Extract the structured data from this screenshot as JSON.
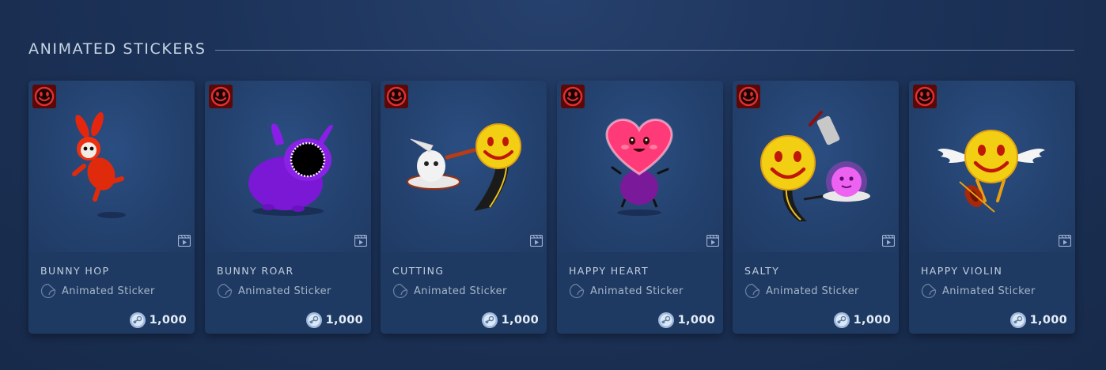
{
  "section": {
    "title": "ANIMATED STICKERS"
  },
  "colors": {
    "background": "#1c3258",
    "card": "#1e3a63",
    "badge": "#5a0808",
    "accent": "#d8b040"
  },
  "cards": [
    {
      "name": "BUNNY HOP",
      "type": "Animated Sticker",
      "price": "1,000",
      "icon": "red-bunny-sticker"
    },
    {
      "name": "BUNNY ROAR",
      "type": "Animated Sticker",
      "price": "1,000",
      "icon": "purple-bunny-sticker"
    },
    {
      "name": "CUTTING",
      "type": "Animated Sticker",
      "price": "1,000",
      "icon": "smiley-cutting-sticker"
    },
    {
      "name": "HAPPY HEART",
      "type": "Animated Sticker",
      "price": "1,000",
      "icon": "heart-sticker"
    },
    {
      "name": "SALTY",
      "type": "Animated Sticker",
      "price": "1,000",
      "icon": "smiley-salt-sticker"
    },
    {
      "name": "HAPPY VIOLIN",
      "type": "Animated Sticker",
      "price": "1,000",
      "icon": "smiley-violin-sticker"
    }
  ]
}
